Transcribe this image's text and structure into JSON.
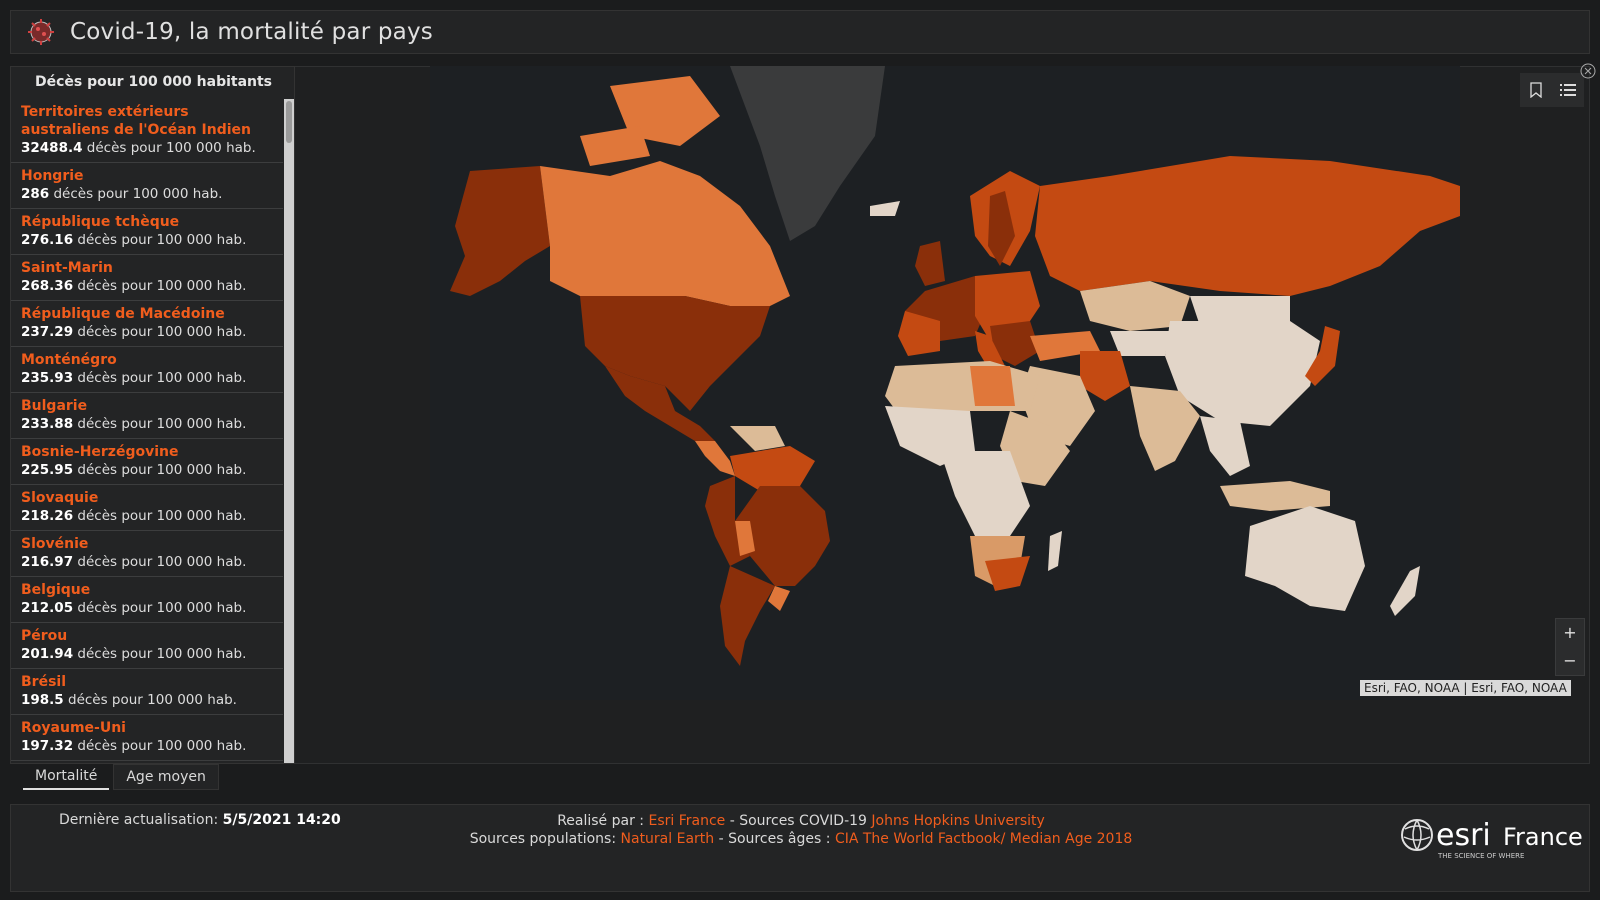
{
  "header": {
    "title": "Covid-19, la mortalité par pays"
  },
  "sidebar": {
    "title": "Décès pour 100 000 habitants",
    "unit_text": " décès pour 100 000 hab.",
    "items": [
      {
        "name": "Territoires extérieurs australiens de l'Océan Indien",
        "value": "32488.4"
      },
      {
        "name": "Hongrie",
        "value": "286"
      },
      {
        "name": "République tchèque",
        "value": "276.16"
      },
      {
        "name": "Saint-Marin",
        "value": "268.36"
      },
      {
        "name": "République de Macédoine",
        "value": "237.29"
      },
      {
        "name": "Monténégro",
        "value": "235.93"
      },
      {
        "name": "Bulgarie",
        "value": "233.88"
      },
      {
        "name": "Bosnie-Herzégovine",
        "value": "225.95"
      },
      {
        "name": "Slovaquie",
        "value": "218.26"
      },
      {
        "name": "Slovénie",
        "value": "216.97"
      },
      {
        "name": "Belgique",
        "value": "212.05"
      },
      {
        "name": "Pérou",
        "value": "201.94"
      },
      {
        "name": "Brésil",
        "value": "198.5"
      },
      {
        "name": "Royaume-Uni",
        "value": "197.32"
      }
    ]
  },
  "map": {
    "attribution": "Esri, FAO, NOAA | Esri, FAO, NOAA",
    "zoom_in": "+",
    "zoom_out": "−",
    "colors": {
      "very_high": "#8a2f0a",
      "high": "#c44a12",
      "mid_high": "#e0773a",
      "mid": "#d99a67",
      "low": "#dcbb97",
      "very_low": "#e2d5c8",
      "no_data": "#3a3b3c",
      "background": "#1d2023"
    }
  },
  "tabs": [
    {
      "label": "Mortalité",
      "active": true
    },
    {
      "label": "Age moyen",
      "active": false
    }
  ],
  "footer": {
    "update_label": "Dernière actualisation:",
    "update_value": "5/5/2021 14:20",
    "line1_a": "Realisé par :",
    "line1_b": "Esri France",
    "line1_c": " -  Sources COVID-19",
    "line1_d": "Johns Hopkins University",
    "line2_a": "Sources populations:",
    "line2_b": "Natural Earth",
    "line2_c": " - Sources âges :",
    "line2_d": "CIA The World Factbook/ Median Age 2018",
    "logo_text": "esri",
    "logo_country": "France",
    "logo_tagline": "THE SCIENCE OF WHERE"
  }
}
